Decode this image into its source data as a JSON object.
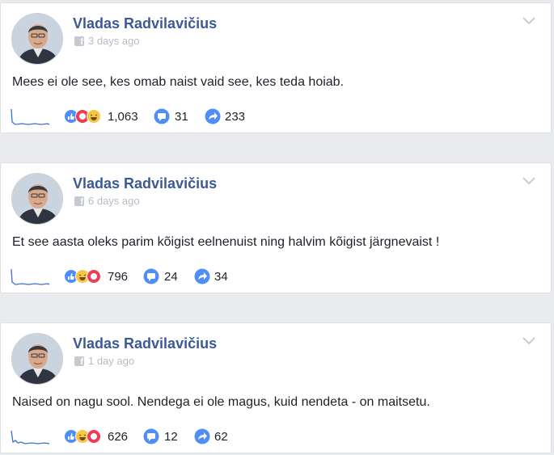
{
  "colors": {
    "author": "#3b5998",
    "like": "#4f8ef7",
    "love": "#f03b54",
    "haha": "#f7c744",
    "comment": "#4f8ef7",
    "share": "#4f8ef7",
    "sparkline": "#3b6fd4"
  },
  "posts": [
    {
      "author": "Vladas Radvilavičius",
      "time": "3 days ago",
      "text": "Mees ei ole see, kes omab naist vaid see, kes teda hoiab.",
      "reactions": [
        "like-icon",
        "love-icon",
        "haha-icon"
      ],
      "reaction_count": "1,063",
      "comment_count": "31",
      "share_count": "233"
    },
    {
      "author": "Vladas Radvilavičius",
      "time": "6 days ago",
      "text": "Et see aasta oleks parim kõigist eelnenuist ning halvim kõigist järgnevaist !",
      "reactions": [
        "like-icon",
        "haha-icon",
        "love-icon"
      ],
      "reaction_count": "796",
      "comment_count": "24",
      "share_count": "34"
    },
    {
      "author": "Vladas Radvilavičius",
      "time": "1 day ago",
      "text": "Naised on nagu sool. Nendega ei ole magus, kuid nendeta - on maitsetu.",
      "reactions": [
        "like-icon",
        "haha-icon",
        "love-icon"
      ],
      "reaction_count": "626",
      "comment_count": "12",
      "share_count": "62"
    }
  ]
}
